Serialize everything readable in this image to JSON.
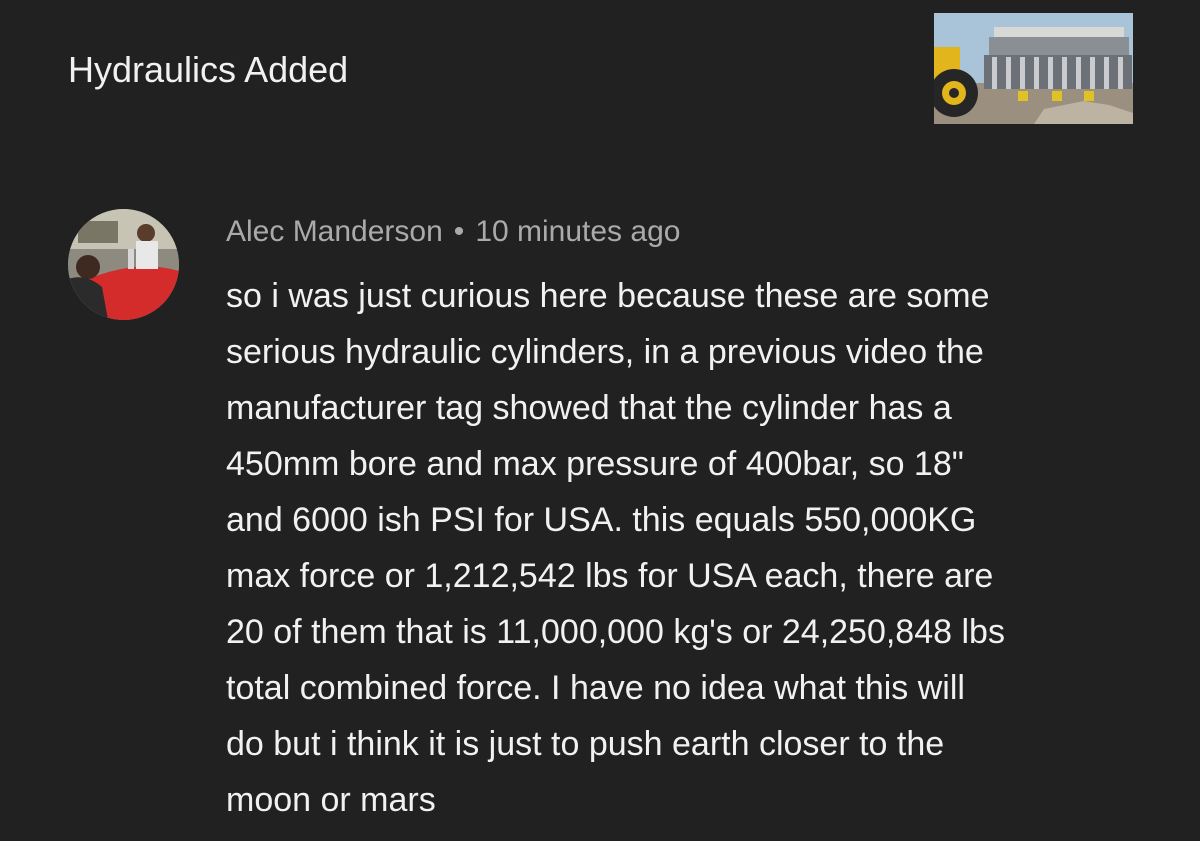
{
  "video": {
    "title": "Hydraulics Added",
    "thumbnail_icon": "hydraulic-structure-thumbnail"
  },
  "comment": {
    "author": "Alec Manderson",
    "separator": "•",
    "timestamp": "10 minutes ago",
    "avatar_icon": "user-avatar-photo",
    "lines": [
      "so i was just curious here because these are some",
      "serious hydraulic cylinders, in a previous video the",
      "manufacturer tag showed that the cylinder has a",
      "450mm bore and max pressure of 400bar, so 18\"",
      "and 6000 ish PSI for USA. this equals 550,000KG",
      "max force or 1,212,542 lbs for USA each, there are",
      "20 of them that is 11,000,000 kg's or 24,250,848 lbs",
      "total combined force. I have no idea what this will",
      "do but i think it is just to push earth closer to the",
      "moon or mars"
    ]
  },
  "colors": {
    "background": "#212121",
    "primary_text": "#f1f1f1",
    "secondary_text": "#aaaaaa"
  }
}
